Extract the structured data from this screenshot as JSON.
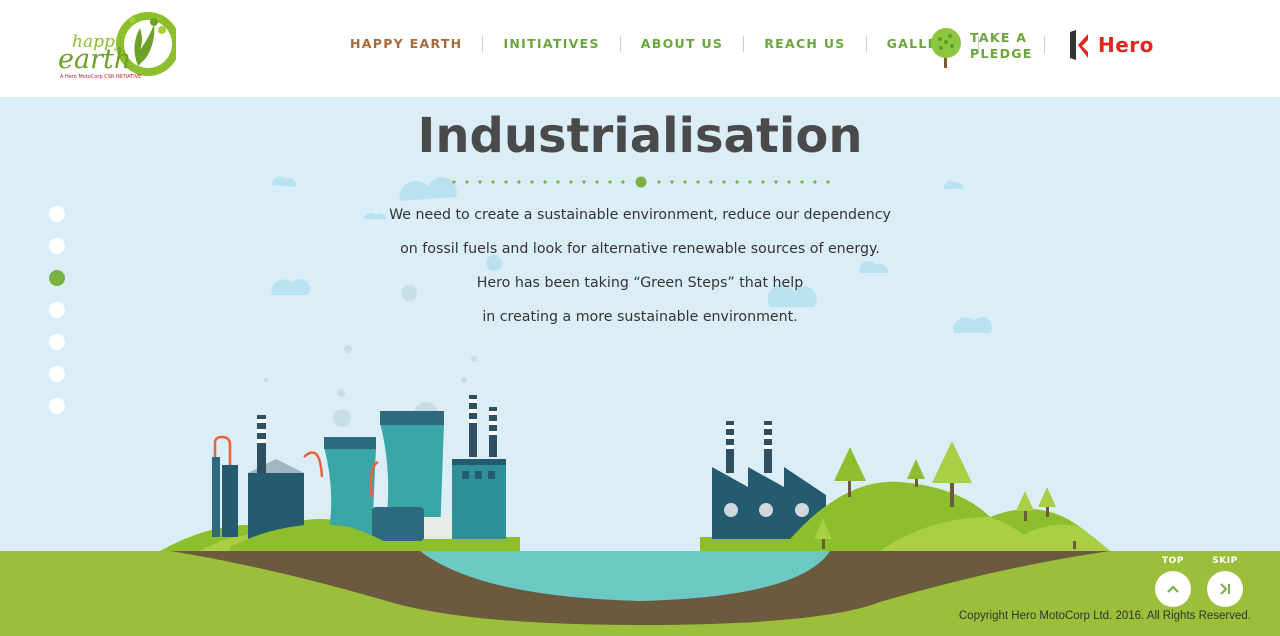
{
  "header": {
    "logo": {
      "line1": "happy",
      "line2": "earth",
      "tagline": "A Hero MotoCorp CSR INITIATIVE"
    },
    "nav": [
      {
        "label": "HAPPY EARTH",
        "name": "nav-happy-earth"
      },
      {
        "label": "INITIATIVES",
        "name": "nav-initiatives"
      },
      {
        "label": "ABOUT US",
        "name": "nav-about-us"
      },
      {
        "label": "REACH US",
        "name": "nav-reach-us"
      },
      {
        "label": "GALLERY",
        "name": "nav-gallery"
      }
    ],
    "pledge": {
      "label": "TAKE A\nPLEDGE"
    },
    "brand": "Hero"
  },
  "main": {
    "title": "Industrialisation",
    "paragraph": [
      "We need to create a sustainable environment, reduce our dependency",
      "on fossil fuels and look for alternative renewable sources of energy.",
      "Hero has been taking “Green Steps” that help",
      "in creating a more sustainable environment."
    ]
  },
  "sidenav": {
    "count": 7,
    "active_index": 2
  },
  "controls": {
    "top_label": "TOP",
    "skip_label": "SKIP"
  },
  "footer": {
    "copyright": "Copyright Hero MotoCorp Ltd. 2016. All Rights Reserved."
  },
  "colors": {
    "sky": "#dbeef8",
    "accent_green": "#7bb043",
    "nav_green": "#6aa63b",
    "nav_brown": "#a56a3d",
    "hero_red": "#e2261c",
    "title_gray": "#4a4a4a",
    "water": "#6ccac5",
    "soil": "#6b5a3e"
  }
}
